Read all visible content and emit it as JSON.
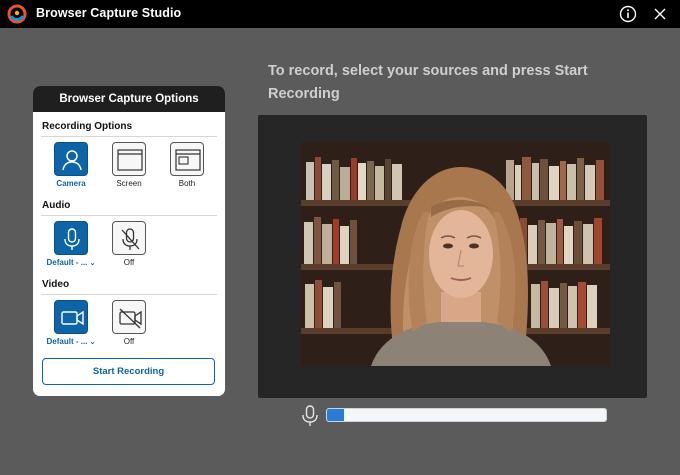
{
  "app": {
    "title": "Browser Capture Studio"
  },
  "panel": {
    "header": "Browser Capture Options",
    "recording": {
      "title": "Recording Options",
      "options": [
        {
          "label": "Camera",
          "icon": "person-icon",
          "selected": true
        },
        {
          "label": "Screen",
          "icon": "window-icon",
          "selected": false
        },
        {
          "label": "Both",
          "icon": "window-overlay-icon",
          "selected": false
        }
      ]
    },
    "audio": {
      "title": "Audio",
      "device_label": "Default - ...",
      "off_label": "Off"
    },
    "video": {
      "title": "Video",
      "device_label": "Default - ...",
      "off_label": "Off"
    },
    "start_button": "Start Recording"
  },
  "main": {
    "instructions": "To record, select your sources and press Start Recording"
  },
  "mic_level": {
    "value": 0.06
  },
  "colors": {
    "accent": "#0d64a6",
    "level": "#2a7bd4",
    "titlebar": "#000000",
    "background": "#5b5b5b"
  }
}
